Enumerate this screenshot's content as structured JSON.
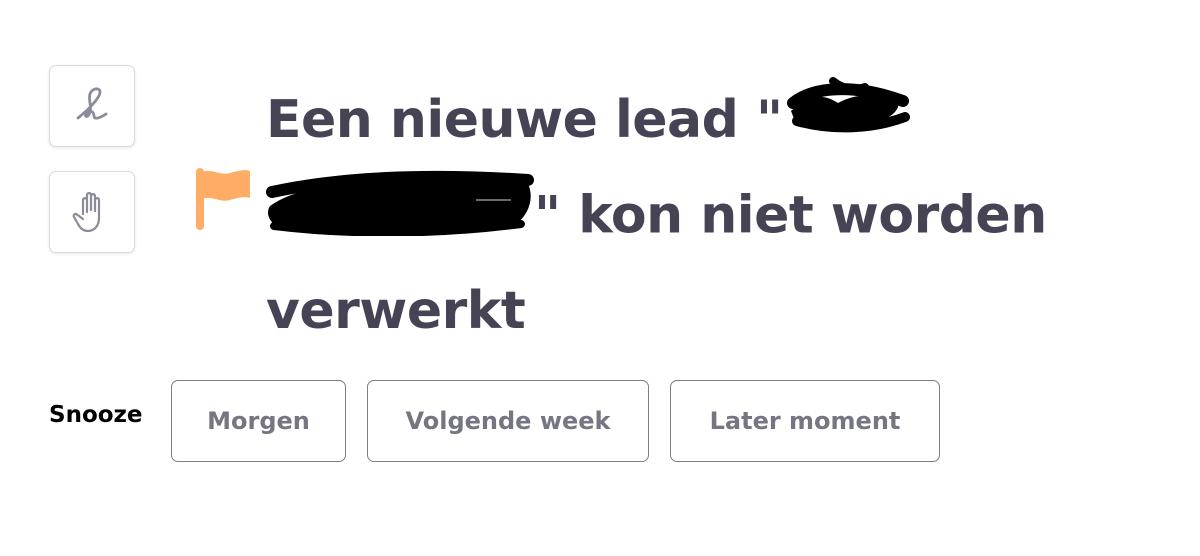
{
  "tools": {
    "signature_icon": "signature-icon",
    "hand_icon": "hand-icon"
  },
  "notification": {
    "flag_icon": "flag-icon",
    "flag_color": "#ffad66",
    "title_line1": "Een nieuwe lead \"",
    "title_line2_end": "\" kon niet worden",
    "title_line3": "verwerkt",
    "title_color": "#454354"
  },
  "snooze": {
    "label": "Snooze",
    "options": [
      "Morgen",
      "Volgende week",
      "Later moment"
    ]
  }
}
